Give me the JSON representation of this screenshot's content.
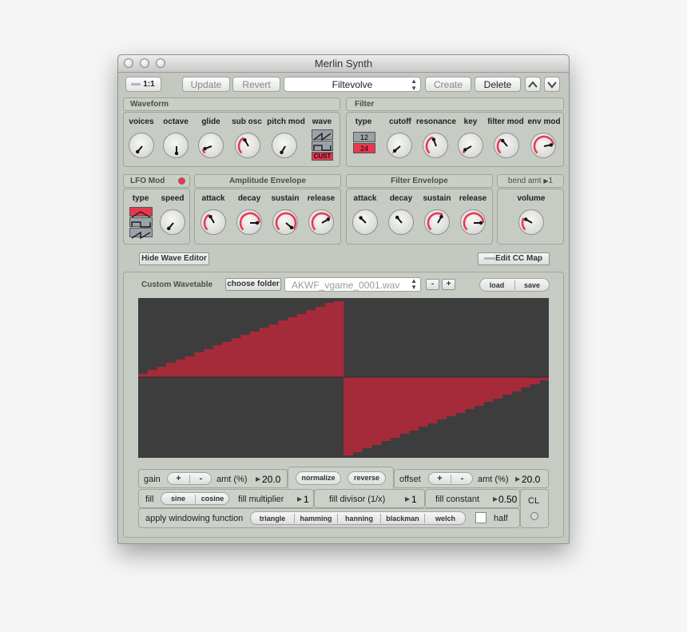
{
  "window": {
    "title": "Merlin Synth"
  },
  "toolbar": {
    "ratio_label": "1:1",
    "update_label": "Update",
    "revert_label": "Revert",
    "preset_value": "Filtevolve",
    "create_label": "Create",
    "delete_label": "Delete"
  },
  "waveform": {
    "title": "Waveform",
    "labels": [
      "voices",
      "octave",
      "glide",
      "sub osc",
      "pitch mod",
      "wave"
    ],
    "cust_label": "CUST"
  },
  "filter": {
    "title": "Filter",
    "labels": [
      "type",
      "cutoff",
      "resonance",
      "key",
      "filter mod",
      "env mod"
    ],
    "type_options": [
      "12",
      "24"
    ]
  },
  "lfo": {
    "title": "LFO Mod",
    "type_label": "type",
    "speed_label": "speed"
  },
  "amp_env": {
    "title": "Amplitude Envelope",
    "labels": [
      "attack",
      "decay",
      "sustain",
      "release"
    ]
  },
  "filter_env": {
    "title": "Filter Envelope",
    "labels": [
      "attack",
      "decay",
      "sustain",
      "release"
    ]
  },
  "bend": {
    "label": "bend amt",
    "value": "1",
    "volume_label": "volume"
  },
  "buttons": {
    "hide_wave_editor": "Hide Wave Editor",
    "edit_cc_map": "Edit CC Map"
  },
  "wavetable": {
    "title": "Custom Wavetable",
    "choose_folder": "choose folder",
    "file_value": "AKWF_vgame_0001.wav",
    "minus": "-",
    "plus": "+",
    "load": "load",
    "save": "save"
  },
  "controls": {
    "gain_label": "gain",
    "plus": "+",
    "minus": "-",
    "amt_label": "amt (%)",
    "gain_amt": "20.0",
    "normalize": "normalize",
    "reverse": "reverse",
    "offset_label": "offset",
    "offset_amt": "20.0",
    "fill_label": "fill",
    "sine": "sine",
    "cosine": "cosine",
    "fill_multiplier_label": "fill multiplier",
    "fill_multiplier": "1",
    "fill_divisor_label": "fill divisor (1/x)",
    "fill_divisor": "1",
    "fill_constant_label": "fill constant",
    "fill_constant": "0.50",
    "cl_label": "CL",
    "windowing_label": "apply windowing function",
    "windows": [
      "triangle",
      "hamming",
      "hanning",
      "blackman",
      "welch"
    ],
    "half_label": "half"
  },
  "colors": {
    "accent": "#e8384f",
    "wave_fill": "#a52a3a",
    "wave_bg": "#3d3d3d"
  }
}
